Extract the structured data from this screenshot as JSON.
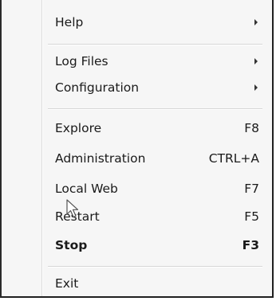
{
  "menu": {
    "items": [
      {
        "label": "Help",
        "shortcut": "",
        "submenu": true,
        "bold": false
      },
      {
        "label": "Log Files",
        "shortcut": "",
        "submenu": true,
        "bold": false
      },
      {
        "label": "Configuration",
        "shortcut": "",
        "submenu": true,
        "bold": false
      },
      {
        "label": "Explore",
        "shortcut": "F8",
        "submenu": false,
        "bold": false
      },
      {
        "label": "Administration",
        "shortcut": "CTRL+A",
        "submenu": false,
        "bold": false
      },
      {
        "label": "Local Web",
        "shortcut": "F7",
        "submenu": false,
        "bold": false
      },
      {
        "label": "Restart",
        "shortcut": "F5",
        "submenu": false,
        "bold": false
      },
      {
        "label": "Stop",
        "shortcut": "F3",
        "submenu": false,
        "bold": true
      },
      {
        "label": "Exit",
        "shortcut": "",
        "submenu": false,
        "bold": false
      }
    ]
  },
  "cursor": {
    "icon": "arrow-pointer-icon"
  }
}
